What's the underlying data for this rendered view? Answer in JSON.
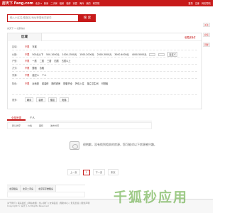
{
  "topbar": {
    "logo": "房天下 Fang.com",
    "city": "北京 ▾",
    "navs": [
      "新房",
      "二手房",
      "租房",
      "装修",
      "家居",
      "海外",
      "我的",
      "研究院"
    ],
    "links": [
      "登录",
      "注册",
      "网站导航"
    ]
  },
  "search": {
    "placeholder": "输入小区名/楼盘名/地址等搜索关键词",
    "button": "搜 索"
  },
  "breadcrumb": "房天下 > 北京房价",
  "panel": {
    "tab": "区域",
    "save": "收藏该条件"
  },
  "filters": [
    {
      "label": "区域:",
      "items": [
        "不限",
        "东城"
      ]
    },
    {
      "label": "价格:",
      "items": [
        "不限",
        "500元以下",
        "500-1000元",
        "1000-1500元",
        "1500-2000元",
        "2000-3000元",
        "3000-4000元",
        "4000-5000元",
        "自定义"
      ]
    },
    {
      "label": "户型:",
      "items": [
        "不限",
        "一居",
        "二居",
        "三居",
        "四居",
        "五居以上"
      ]
    },
    {
      "label": "方式:",
      "items": [
        "不限",
        "整租",
        "合租"
      ]
    },
    {
      "label": "来源:",
      "items": [
        "不限",
        "经纪人",
        "个人"
      ]
    },
    {
      "label": "特色:",
      "items": [
        "不限",
        "近地铁",
        "精装修",
        "随时看房",
        "配套齐全",
        "拎包入住",
        "独立卫生间",
        "可短租"
      ]
    },
    {
      "label": "更多:",
      "items": [
        "朝向",
        "装修",
        "楼层",
        "电梯"
      ]
    }
  ],
  "sort": {
    "tabs": [
      "全部房源",
      "个人"
    ],
    "opts": [
      "默认排序",
      "价格",
      "面积",
      "发布时间"
    ]
  },
  "empty": {
    "text": "很抱歉，没有找到相关的房源，您可能对以下房源感兴趣。"
  },
  "pager": {
    "prev": "上一页",
    "cur": "1",
    "next": "下一页",
    "last": "末页"
  },
  "related": {
    "tabs": [
      "北京租房",
      "北京二手房",
      "北京写字楼租房"
    ]
  },
  "footer": {
    "lines": [
      "关于我们 | 联系我们 | 网站地图 | 加入我们 | 友情链接 | 帮助中心 | 意见反馈 | 服务声明",
      "Copyright © 房天下 All Rights Reserved"
    ]
  },
  "sidebar": {
    "items": [
      "关注",
      "反馈",
      "顶部"
    ]
  },
  "watermark": "千狐秒应用",
  "colors": {
    "brand": "#c71a1a"
  }
}
